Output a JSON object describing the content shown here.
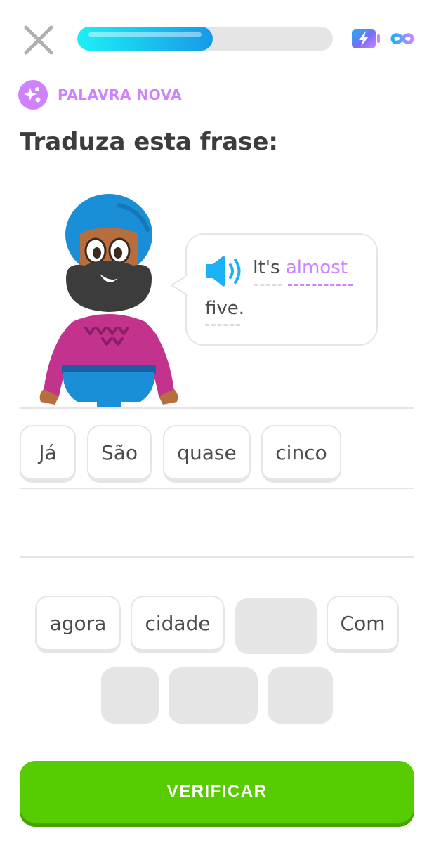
{
  "header": {
    "close_icon": "close-icon",
    "progress_fraction": 0.53,
    "energy_icon": "energy-battery-icon",
    "infinity_icon": "infinity-icon"
  },
  "badge": {
    "label": "PALAVRA NOVA",
    "icon": "new-word-sparkle-icon"
  },
  "instruction": "Traduza esta frase:",
  "prompt": {
    "speaker_icon": "speaker-icon",
    "word1": "It's",
    "word2": "almost",
    "word3": "five."
  },
  "answer_tiles": [
    "Já",
    "São",
    "quase",
    "cinco"
  ],
  "word_bank": [
    "agora",
    "cidade",
    "Com"
  ],
  "verify_label": "VERIFICAR",
  "colors": {
    "accent_purple": "#ce82ff",
    "progress_start": "#1cf0f5",
    "progress_end": "#1899e8",
    "button_green": "#58cc02",
    "button_shadow": "#46a302",
    "border_gray": "#e5e5e5"
  }
}
